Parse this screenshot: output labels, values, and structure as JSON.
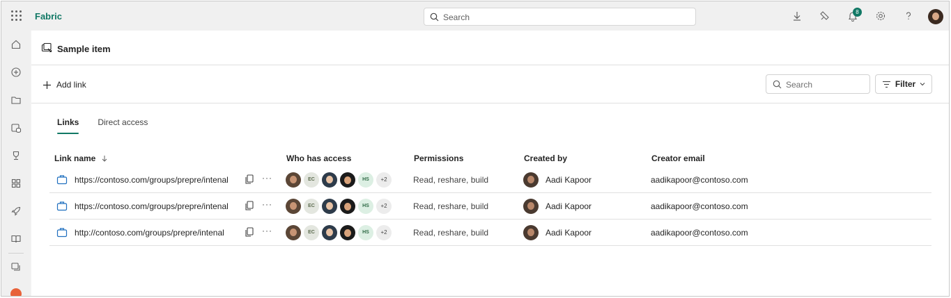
{
  "app": {
    "name": "Fabric"
  },
  "top_search": {
    "placeholder": "Search"
  },
  "notifications": {
    "count": "8"
  },
  "header": {
    "title": "Sample item"
  },
  "toolbar": {
    "add_link_label": "Add link",
    "search_placeholder": "Search",
    "filter_label": "Filter"
  },
  "tabs": [
    {
      "label": "Links",
      "active": true
    },
    {
      "label": "Direct access",
      "active": false
    }
  ],
  "table": {
    "columns": {
      "link_name": "Link name",
      "who_has_access": "Who has access",
      "permissions": "Permissions",
      "created_by": "Created by",
      "creator_email": "Creator email"
    },
    "rows": [
      {
        "url": "https://contoso.com/groups/prepre/intenal",
        "access_initials": [
          "EC",
          "HS"
        ],
        "access_more": "+2",
        "permissions": "Read, reshare, build",
        "created_by": "Aadi Kapoor",
        "creator_email": "aadikapoor@contoso.com"
      },
      {
        "url": "https://contoso.com/groups/prepre/intenal",
        "access_initials": [
          "EC",
          "HS"
        ],
        "access_more": "+2",
        "permissions": "Read, reshare, build",
        "created_by": "Aadi Kapoor",
        "creator_email": "aadikapoor@contoso.com"
      },
      {
        "url": "http://contoso.com/groups/prepre/intenal",
        "access_initials": [
          "EC",
          "HS"
        ],
        "access_more": "+2",
        "permissions": "Read, reshare, build",
        "created_by": "Aadi Kapoor",
        "creator_email": "aadikapoor@contoso.com"
      }
    ]
  },
  "colors": {
    "brand": "#117865",
    "badge": "#117865"
  }
}
